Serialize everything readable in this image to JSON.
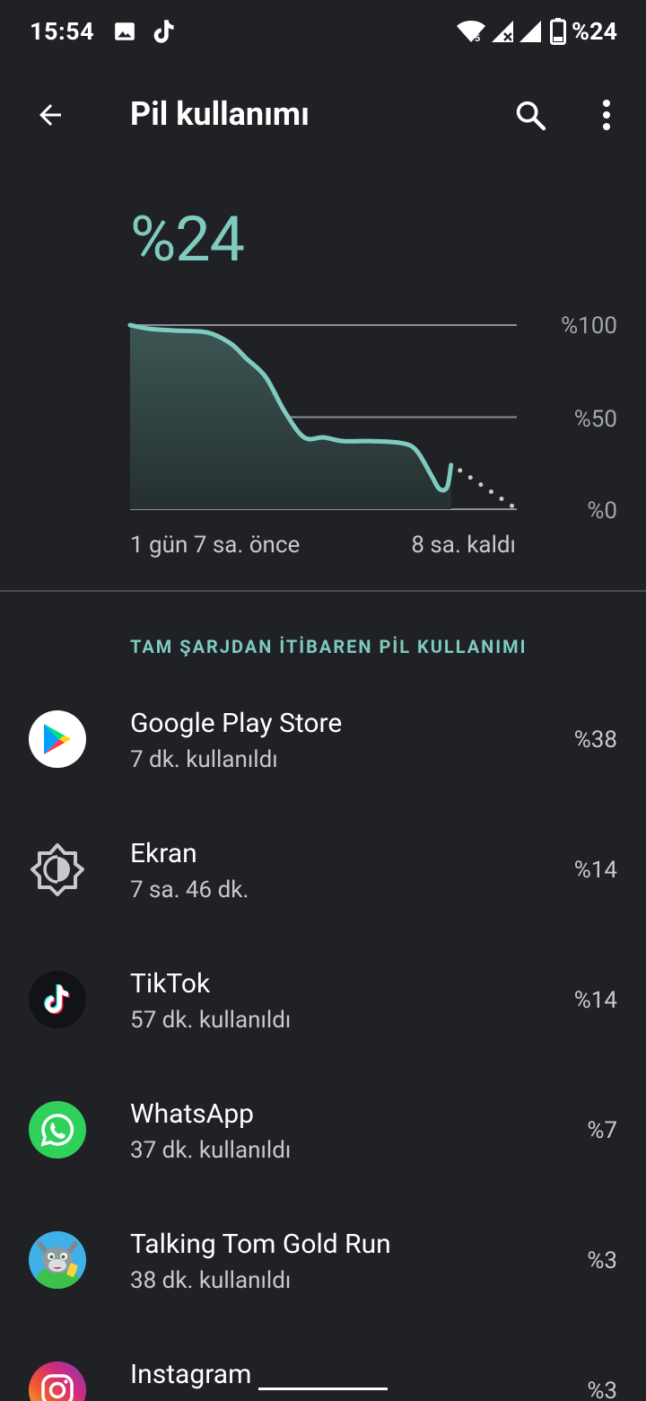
{
  "status_bar": {
    "time": "15:54",
    "icons": [
      "image-icon",
      "tiktok-icon",
      "wifi-icon",
      "signal-icon",
      "battery-icon"
    ],
    "wifi_badge": "5",
    "battery_text": "%24"
  },
  "app_bar": {
    "title": "Pil kullanımı",
    "back_icon": "arrow-back-icon",
    "search_icon": "search-icon",
    "more_icon": "more-vert-icon"
  },
  "summary": {
    "battery_level": "%24",
    "chart_data": {
      "type": "line",
      "title": "",
      "y_ticks": [
        "%100",
        "%50",
        "%0"
      ],
      "ylim": [
        0,
        100
      ],
      "x_start_label": "1 gün 7 sa. önce",
      "x_end_label": "8 sa. kaldı",
      "accent": "#7fcbc0",
      "series": [
        {
          "values": [
            {
              "t": 0.0,
              "y": 100
            },
            {
              "t": 0.05,
              "y": 98
            },
            {
              "t": 0.12,
              "y": 97
            },
            {
              "t": 0.2,
              "y": 96
            },
            {
              "t": 0.26,
              "y": 90
            },
            {
              "t": 0.3,
              "y": 82
            },
            {
              "t": 0.35,
              "y": 72
            },
            {
              "t": 0.4,
              "y": 53
            },
            {
              "t": 0.45,
              "y": 39
            },
            {
              "t": 0.5,
              "y": 39
            },
            {
              "t": 0.55,
              "y": 37
            },
            {
              "t": 0.62,
              "y": 37
            },
            {
              "t": 0.7,
              "y": 36
            },
            {
              "t": 0.74,
              "y": 32
            },
            {
              "t": 0.78,
              "y": 18
            },
            {
              "t": 0.8,
              "y": 11
            },
            {
              "t": 0.82,
              "y": 12
            },
            {
              "t": 0.83,
              "y": 24
            }
          ]
        },
        {
          "values": [
            {
              "t": 0.83,
              "y": 24
            },
            {
              "t": 1.0,
              "y": 0
            }
          ]
        }
      ]
    }
  },
  "section_header": "TAM ŞARJDAN İTİBAREN PİL KULLANIMI",
  "apps": [
    {
      "name": "Google Play Store",
      "sub": "7 dk. kullanıldı",
      "percent": "%38",
      "icon": "google-play-icon"
    },
    {
      "name": "Ekran",
      "sub": "7 sa. 46 dk.",
      "percent": "%14",
      "icon": "brightness-icon"
    },
    {
      "name": "TikTok",
      "sub": "57 dk. kullanıldı",
      "percent": "%14",
      "icon": "tiktok-icon"
    },
    {
      "name": "WhatsApp",
      "sub": "37 dk. kullanıldı",
      "percent": "%7",
      "icon": "whatsapp-icon"
    },
    {
      "name": "Talking Tom Gold Run",
      "sub": "38 dk. kullanıldı",
      "percent": "%3",
      "icon": "talking-tom-icon"
    },
    {
      "name": "Instagram",
      "sub": "",
      "percent": "%3",
      "icon": "instagram-icon"
    }
  ]
}
